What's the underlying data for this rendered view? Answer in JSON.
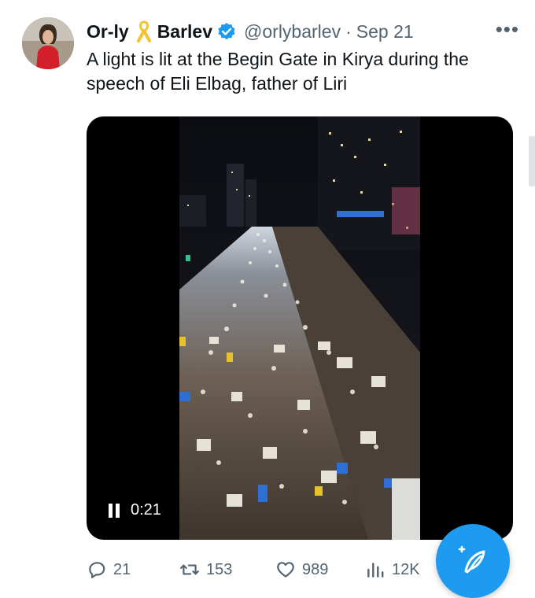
{
  "author": {
    "name_first": "Or-ly",
    "name_last": "Barlev",
    "handle": "@orlybarlev",
    "separator": "·",
    "date": "Sep 21",
    "ribbon_icon": "yellow-ribbon-icon",
    "verified_icon": "verified-badge-icon"
  },
  "more_label": "•••",
  "tweet": {
    "text": "A light is lit at the Begin Gate in Kirya during the speech of Eli Elbag, father of Liri"
  },
  "video": {
    "time": "0:21",
    "state_icon": "pause-icon"
  },
  "actions": {
    "replies": "21",
    "retweets": "153",
    "likes": "989",
    "views": "12K"
  },
  "colors": {
    "accent": "#1d9bf0",
    "ribbon": "#f5c230",
    "muted": "#536471",
    "text": "#0f1419"
  }
}
